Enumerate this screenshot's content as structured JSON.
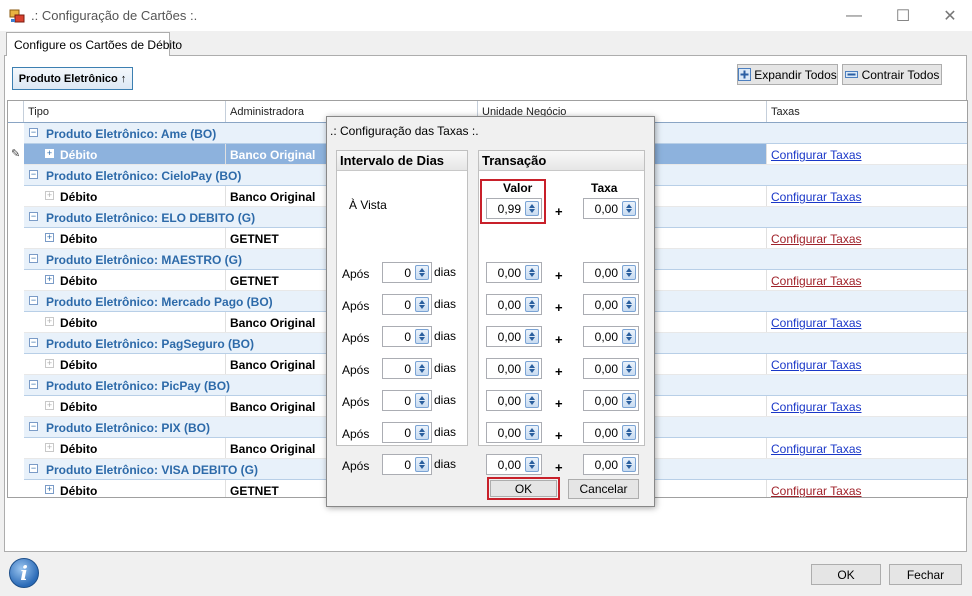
{
  "window": {
    "title": ".: Configuração de Cartões :.",
    "minimize": "—",
    "maximize": "☐",
    "close": "✕"
  },
  "tab": {
    "label": "Configure os Cartões de Débito"
  },
  "toolbar": {
    "sort_label": "Produto Eletrônico ↑",
    "expand_label": "Expandir Todos",
    "collapse_label": "Contrair Todos"
  },
  "grid": {
    "columns": [
      "Tipo",
      "Administradora",
      "Unidade Negócio",
      "Taxas"
    ],
    "groups": [
      {
        "title": "Produto Eletrônico: Ame (BO)",
        "item": "Débito",
        "admin": "Banco Original",
        "taxas": "Configurar Taxas",
        "selected": true,
        "link_color": "blue"
      },
      {
        "title": "Produto Eletrônico: CieloPay (BO)",
        "item": "Débito",
        "admin": "Banco Original",
        "taxas": "Configurar Taxas",
        "selected": false,
        "link_color": "blue"
      },
      {
        "title": "Produto Eletrônico: ELO DEBITO (G)",
        "item": "Débito",
        "admin": "GETNET",
        "taxas": "Configurar Taxas",
        "selected": false,
        "link_color": "red"
      },
      {
        "title": "Produto Eletrônico: MAESTRO (G)",
        "item": "Débito",
        "admin": "GETNET",
        "taxas": "Configurar Taxas",
        "selected": false,
        "link_color": "red"
      },
      {
        "title": "Produto Eletrônico: Mercado Pago (BO)",
        "item": "Débito",
        "admin": "Banco Original",
        "taxas": "Configurar Taxas",
        "selected": false,
        "link_color": "blue"
      },
      {
        "title": "Produto Eletrônico: PagSeguro (BO)",
        "item": "Débito",
        "admin": "Banco Original",
        "taxas": "Configurar Taxas",
        "selected": false,
        "link_color": "blue"
      },
      {
        "title": "Produto Eletrônico: PicPay (BO)",
        "item": "Débito",
        "admin": "Banco Original",
        "taxas": "Configurar Taxas",
        "selected": false,
        "link_color": "blue"
      },
      {
        "title": "Produto Eletrônico: PIX (BO)",
        "item": "Débito",
        "admin": "Banco Original",
        "taxas": "Configurar Taxas",
        "selected": false,
        "link_color": "blue"
      },
      {
        "title": "Produto Eletrônico: VISA DEBITO (G)",
        "item": "Débito",
        "admin": "GETNET",
        "taxas": "Configurar Taxas",
        "selected": false,
        "link_color": "red"
      }
    ]
  },
  "dialog": {
    "title": ".: Configuração das Taxas :.",
    "intervalo_header": "Intervalo de Dias",
    "transacao_header": "Transação",
    "valor_header": "Valor",
    "taxa_header": "Taxa",
    "a_vista": "À Vista",
    "apos": "Após",
    "dias": "dias",
    "plus": "+",
    "rows": [
      {
        "dias": "",
        "valor": "0,99",
        "taxa": "0,00"
      },
      {
        "dias": "0",
        "valor": "0,00",
        "taxa": "0,00"
      },
      {
        "dias": "0",
        "valor": "0,00",
        "taxa": "0,00"
      },
      {
        "dias": "0",
        "valor": "0,00",
        "taxa": "0,00"
      },
      {
        "dias": "0",
        "valor": "0,00",
        "taxa": "0,00"
      },
      {
        "dias": "0",
        "valor": "0,00",
        "taxa": "0,00"
      },
      {
        "dias": "0",
        "valor": "0,00",
        "taxa": "0,00"
      },
      {
        "dias": "0",
        "valor": "0,00",
        "taxa": "0,00"
      }
    ],
    "ok_label": "OK",
    "cancel_label": "Cancelar"
  },
  "footer": {
    "info_icon": "i",
    "ok_label": "OK",
    "close_label": "Fechar"
  },
  "colors": {
    "group_text": "#2d6aa9",
    "selected_row": "#8db2dd",
    "link_blue": "#1a37c8",
    "link_red": "#a0222a",
    "highlight_box": "#c8202a"
  }
}
